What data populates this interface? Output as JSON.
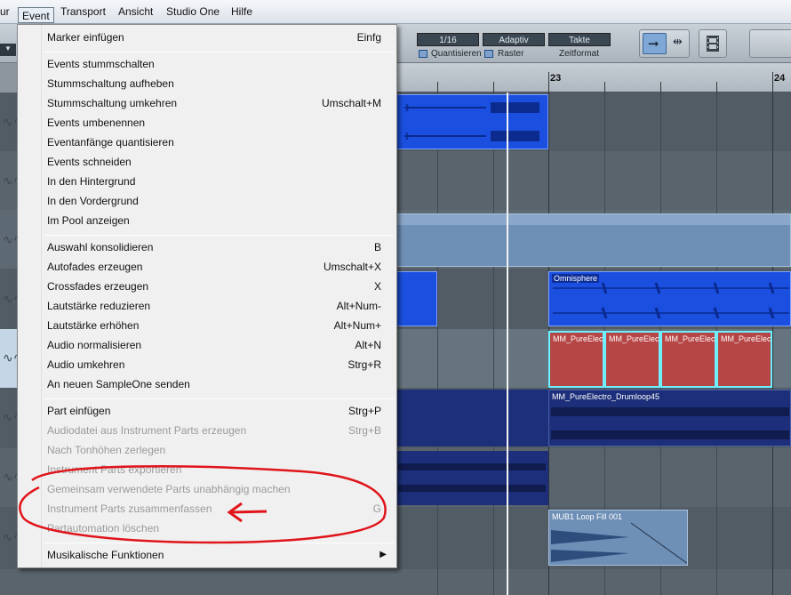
{
  "menubar": {
    "items": [
      {
        "label": "ur"
      },
      {
        "label": "Event"
      },
      {
        "label": "Transport"
      },
      {
        "label": "Ansicht"
      },
      {
        "label": "Studio One"
      },
      {
        "label": "Hilfe"
      }
    ]
  },
  "toolbar": {
    "quantize_value": "1/16",
    "quantize_label": "Quantisieren",
    "snap_value": "Adaptiv",
    "snap_label": "Raster",
    "timebase_value": "Takte",
    "timebase_label": "Zeitformat"
  },
  "ruler": {
    "bar_23": "23",
    "bar_24": "24"
  },
  "events": {
    "omnisphere": "Omnisphere",
    "pure_electro": "MM_PureElectro",
    "drumloop": "MM_PureElectro_Drumloop45",
    "loop_fill": "MUB1 Loop Fill 001"
  },
  "event_menu": {
    "items": [
      {
        "label": "Marker einfügen",
        "shortcut": "Einfg",
        "enabled": true
      },
      {
        "label": "Events stummschalten",
        "shortcut": "",
        "enabled": true
      },
      {
        "label": "Stummschaltung aufheben",
        "shortcut": "",
        "enabled": true
      },
      {
        "label": "Stummschaltung umkehren",
        "shortcut": "Umschalt+M",
        "enabled": true
      },
      {
        "label": "Events umbenennen",
        "shortcut": "",
        "enabled": true
      },
      {
        "label": "Eventanfänge quantisieren",
        "shortcut": "",
        "enabled": true
      },
      {
        "label": "Events schneiden",
        "shortcut": "",
        "enabled": true
      },
      {
        "label": "In den Hintergrund",
        "shortcut": "",
        "enabled": true
      },
      {
        "label": "In den Vordergrund",
        "shortcut": "",
        "enabled": true
      },
      {
        "label": "Im Pool anzeigen",
        "shortcut": "",
        "enabled": true
      },
      {
        "label": "Auswahl konsolidieren",
        "shortcut": "B",
        "enabled": true
      },
      {
        "label": "Autofades erzeugen",
        "shortcut": "Umschalt+X",
        "enabled": true
      },
      {
        "label": "Crossfades erzeugen",
        "shortcut": "X",
        "enabled": true
      },
      {
        "label": "Lautstärke reduzieren",
        "shortcut": "Alt+Num-",
        "enabled": true
      },
      {
        "label": "Lautstärke erhöhen",
        "shortcut": "Alt+Num+",
        "enabled": true
      },
      {
        "label": "Audio normalisieren",
        "shortcut": "Alt+N",
        "enabled": true
      },
      {
        "label": "Audio umkehren",
        "shortcut": "Strg+R",
        "enabled": true
      },
      {
        "label": "An neuen SampleOne senden",
        "shortcut": "",
        "enabled": true
      },
      {
        "label": "Part einfügen",
        "shortcut": "Strg+P",
        "enabled": true
      },
      {
        "label": "Audiodatei aus Instrument Parts erzeugen",
        "shortcut": "Strg+B",
        "enabled": false
      },
      {
        "label": "Nach Tonhöhen zerlegen",
        "shortcut": "",
        "enabled": false
      },
      {
        "label": "Instrument Parts exportieren",
        "shortcut": "",
        "enabled": false
      },
      {
        "label": "Gemeinsam verwendete Parts unabhängig machen",
        "shortcut": "",
        "enabled": false
      },
      {
        "label": "Instrument Parts zusammenfassen",
        "shortcut": "G",
        "enabled": false
      },
      {
        "label": "Partautomation löschen",
        "shortcut": "",
        "enabled": false
      },
      {
        "label": "Musikalische Funktionen",
        "shortcut": "",
        "enabled": true
      }
    ]
  },
  "colors": {
    "audio_blue": "#1a4fe0",
    "drum_navy": "#1d2f7a",
    "fill_steel": "#6e8fb6",
    "red_part": "#b64545",
    "annotation_red": "#e0141a"
  }
}
